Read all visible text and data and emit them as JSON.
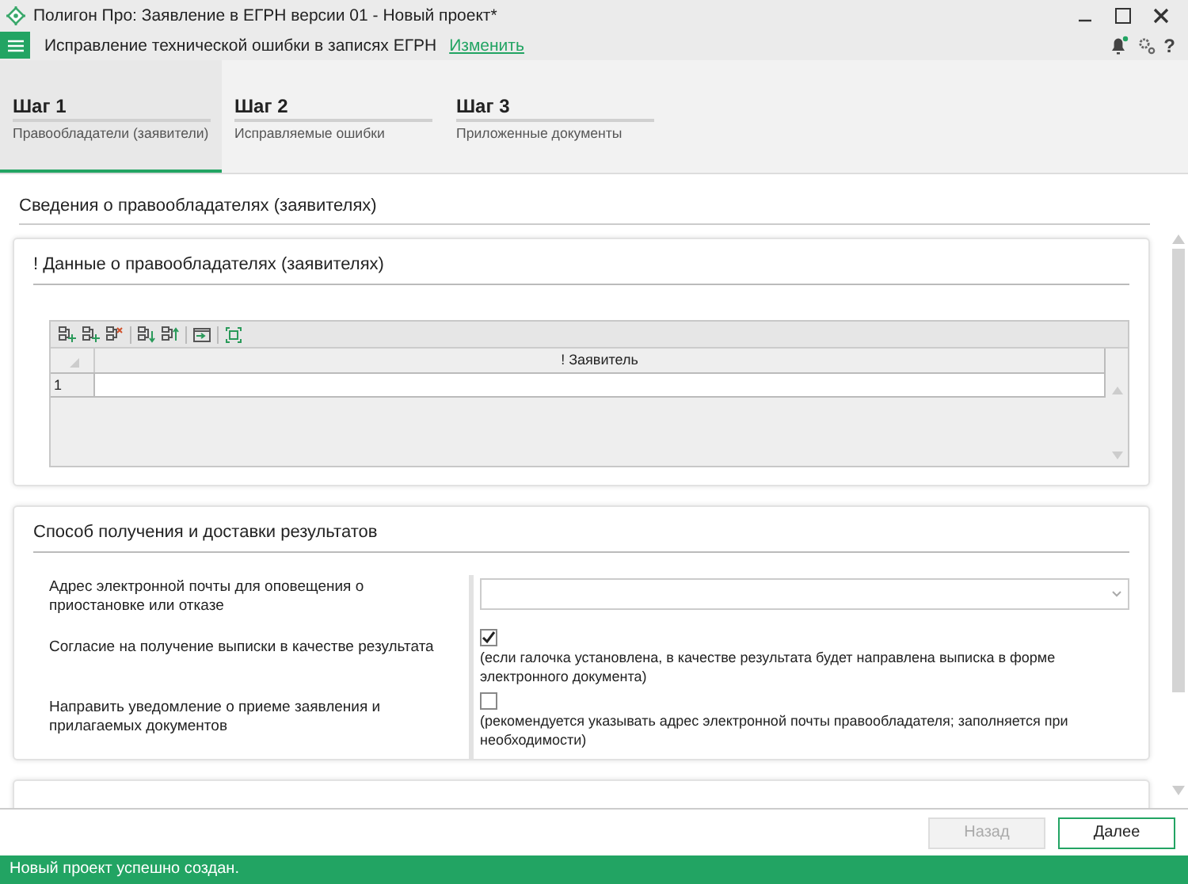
{
  "window": {
    "title": "Полигон Про: Заявление в ЕГРН версии 01 - Новый проект*"
  },
  "toolbar": {
    "mode": "Исправление технической ошибки в записях ЕГРН",
    "change_link": "Изменить",
    "help": "?"
  },
  "steps": [
    {
      "title": "Шаг 1",
      "subtitle": "Правообладатели (заявители)",
      "selected": true
    },
    {
      "title": "Шаг 2",
      "subtitle": "Исправляемые ошибки",
      "selected": false
    },
    {
      "title": "Шаг 3",
      "subtitle": "Приложенные документы",
      "selected": false
    }
  ],
  "section_title": "Сведения о правообладателях (заявителях)",
  "owners_card": {
    "title": "! Данные о правообладателях (заявителях)",
    "grid": {
      "columns": [
        "! Заявитель"
      ],
      "rows": [
        {
          "number": "1"
        }
      ]
    }
  },
  "delivery_card": {
    "title": "Способ получения и доставки результатов",
    "fields": [
      {
        "kind": "dropdown",
        "label": "Адрес электронной почты для оповещения о приостановке или отказе"
      },
      {
        "kind": "checkbox",
        "label": "Согласие на получение выписки в качестве результата",
        "checked": true,
        "hint": "(если галочка установлена, в качестве результата будет направлена выписка в форме электронного документа)"
      },
      {
        "kind": "checkbox",
        "label": "Направить уведомление о приеме заявления и прилагаемых документов",
        "checked": false,
        "hint": "(рекомендуется указывать адрес электронной почты правообладателя; заполняется при необходимости)"
      }
    ]
  },
  "buttons": [
    {
      "label": "Назад",
      "disabled": true
    },
    {
      "label": "Далее",
      "disabled": false
    }
  ],
  "status_bar": "Новый проект успешно создан."
}
